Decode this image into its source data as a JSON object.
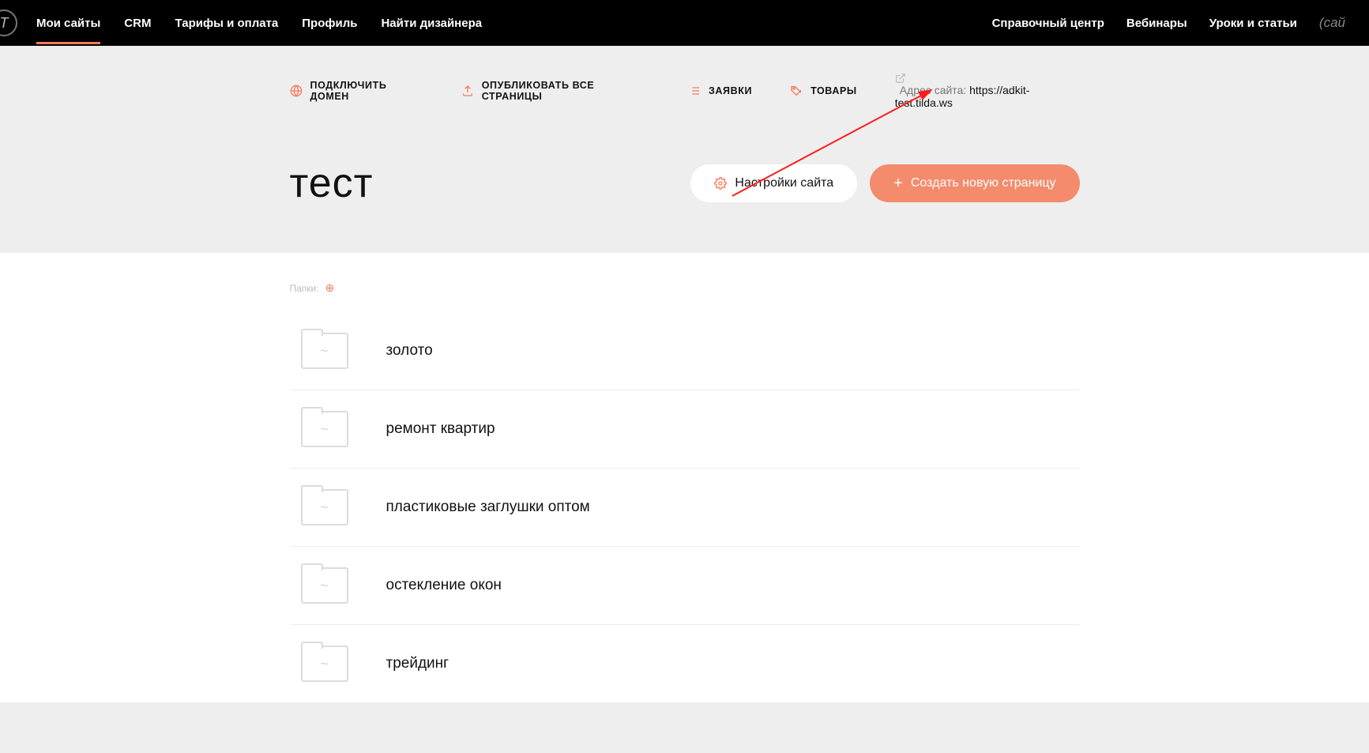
{
  "nav": {
    "left": [
      {
        "label": "Мои сайты",
        "active": true
      },
      {
        "label": "CRM",
        "active": false
      },
      {
        "label": "Тарифы и оплата",
        "active": false
      },
      {
        "label": "Профиль",
        "active": false
      },
      {
        "label": "Найти дизайнера",
        "active": false
      }
    ],
    "right": [
      {
        "label": "Справочный центр"
      },
      {
        "label": "Вебинары"
      },
      {
        "label": "Уроки и статьи"
      }
    ],
    "tag": "(сай"
  },
  "actions": {
    "domain": "ПОДКЛЮЧИТЬ ДОМЕН",
    "publish": "ОПУБЛИКОВАТЬ ВСЕ СТРАНИЦЫ",
    "leads": "ЗАЯВКИ",
    "products": "ТОВАРЫ",
    "site_label": "Адрес сайта:",
    "site_url": "https://adkit-test.tilda.ws"
  },
  "site": {
    "title": "тест",
    "settings_btn": "Настройки сайта",
    "create_btn": "Создать новую страницу"
  },
  "folders": {
    "label": "Папки:",
    "items": [
      {
        "name": "золото"
      },
      {
        "name": "ремонт квартир"
      },
      {
        "name": "пластиковые заглушки оптом"
      },
      {
        "name": "остекление окон"
      },
      {
        "name": "трейдинг"
      }
    ]
  }
}
